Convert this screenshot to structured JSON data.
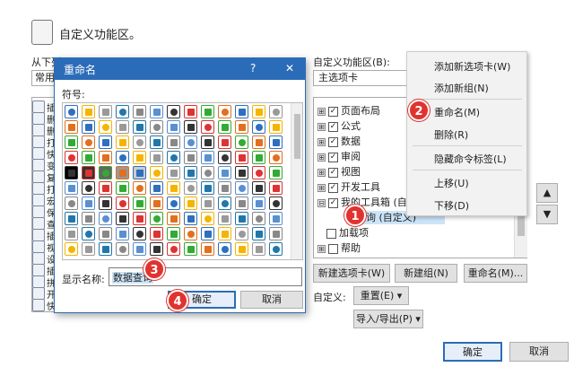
{
  "main": {
    "title": "自定义功能区。",
    "choose_label": "从下列",
    "choose_value": "常用",
    "customize_label": "自定义功能区(B):",
    "customize_value": "主选项卡",
    "left_items": [
      "插",
      "删",
      "删",
      "打",
      "快",
      "变",
      "复",
      "打",
      "宏",
      "保",
      "查",
      "插",
      "视",
      "设",
      "插",
      "拼",
      "开始计算",
      "快速打印"
    ],
    "tree": [
      {
        "toggle": "⊞",
        "checked": true,
        "label": "页面布局"
      },
      {
        "toggle": "⊞",
        "checked": true,
        "label": "公式"
      },
      {
        "toggle": "⊞",
        "checked": true,
        "label": "数据"
      },
      {
        "toggle": "⊞",
        "checked": true,
        "label": "审阅"
      },
      {
        "toggle": "⊞",
        "checked": true,
        "label": "视图"
      },
      {
        "toggle": "⊞",
        "checked": true,
        "label": "开发工具"
      },
      {
        "toggle": "⊟",
        "checked": true,
        "label": "我的工具箱 (自定"
      },
      {
        "toggle": "",
        "checked": false,
        "label": "据查询 (自定义)"
      },
      {
        "toggle": "",
        "checked": false,
        "label": "加载项"
      },
      {
        "toggle": "⊞",
        "checked": false,
        "label": "帮助"
      }
    ],
    "new_tab_btn": "新建选项卡(W)",
    "new_group_btn": "新建组(N)",
    "rename_btn": "重命名(M)...",
    "customize_text": "自定义:",
    "reset_btn": "重置(E) ▾",
    "import_export_btn": "导入/导出(P) ▾",
    "ok": "确定",
    "cancel": "取消",
    "up_arrow": "▲",
    "down_arrow": "▼"
  },
  "context_menu": {
    "items": [
      "添加新选项卡(W)",
      "添加新组(N)",
      "重命名(M)",
      "删除(R)",
      "隐藏命令标签(L)",
      "上移(U)",
      "下移(D)"
    ]
  },
  "rename_dialog": {
    "title": "重命名",
    "help": "?",
    "close": "✕",
    "symbol_label": "符号:",
    "display_name_label": "显示名称:",
    "display_name_value": "数据查询",
    "ok": "确定",
    "cancel": "取消"
  },
  "badges": [
    "1",
    "2",
    "3",
    "4"
  ],
  "colors": {
    "accent": "#2b6cb8",
    "titlebar": "#2b6cb8",
    "badge": "#e0332f",
    "selection": "#cce4f7"
  }
}
